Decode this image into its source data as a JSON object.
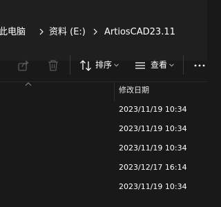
{
  "breadcrumb": {
    "items": [
      {
        "label": "此电脑"
      },
      {
        "label": "资料 (E:)"
      },
      {
        "label": "ArtiosCAD23.11"
      }
    ]
  },
  "toolbar": {
    "sort_label": "排序",
    "view_label": "查看"
  },
  "columns": {
    "modified_date": "修改日期"
  },
  "rows": [
    {
      "modified": "2023/11/19 10:34"
    },
    {
      "modified": "2023/11/19 10:34"
    },
    {
      "modified": "2023/11/19 10:34"
    },
    {
      "modified": "2023/12/17 16:14"
    },
    {
      "modified": "2023/11/19 10:34"
    }
  ],
  "colors": {
    "background": "#191919",
    "address_bar": "#1f1f1f",
    "text": "#ffffff",
    "disabled_icon": "#5a5a5a"
  }
}
